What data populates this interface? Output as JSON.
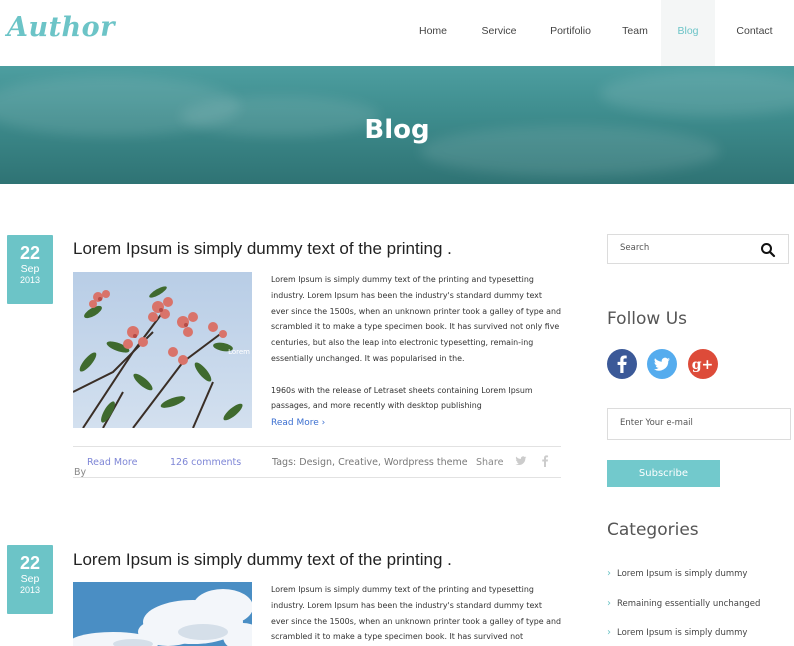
{
  "header": {
    "logo": "Author",
    "nav": [
      {
        "label": "Home",
        "active": false
      },
      {
        "label": "Service",
        "active": false
      },
      {
        "label": "Portifolio",
        "active": false
      },
      {
        "label": "Team",
        "active": false
      },
      {
        "label": "Blog",
        "active": true
      },
      {
        "label": "Contact",
        "active": false
      }
    ]
  },
  "hero": {
    "title": "Blog"
  },
  "posts": [
    {
      "day": "22",
      "month": "Sep",
      "year": "2013",
      "title": "Lorem Ipsum is simply dummy text of the printing .",
      "image_caption": "Lorem",
      "paragraph1": "Lorem Ipsum is simply dummy text of the printing and typesetting industry. Lorem Ipsum has been the industry's standard dummy text ever since the 1500s, when an unknown printer took a galley of type and scrambled it to make a type specimen book. It has survived not only five centuries, but also the leap into electronic typesetting, remain-ing essentially unchanged. It was popularised in the.",
      "paragraph2": "1960s with the release of Letraset sheets containing Lorem Ipsum passages, and more recently with desktop publishing",
      "read_more": "Read More",
      "by_label": "By",
      "by_link": "Read More",
      "comments": "126 comments",
      "tags": "Tags: Design, Creative, Wordpress theme",
      "share_label": "Share"
    },
    {
      "day": "22",
      "month": "Sep",
      "year": "2013",
      "title": "Lorem Ipsum is simply dummy text of the printing .",
      "paragraph1": "Lorem Ipsum is simply dummy text of the printing and typesetting industry. Lorem Ipsum has been the industry's standard dummy text ever since the 1500s, when an unknown printer took a galley of type and scrambled it to make a type specimen book. It has survived not"
    }
  ],
  "sidebar": {
    "search_placeholder": "Search",
    "follow_heading": "Follow Us",
    "social": [
      {
        "name": "facebook",
        "glyph": "f",
        "color": "#3b5998"
      },
      {
        "name": "twitter",
        "glyph": "t",
        "color": "#55acee"
      },
      {
        "name": "google-plus",
        "glyph": "g+",
        "color": "#dd4b39"
      }
    ],
    "email_placeholder": "Enter Your e-mail",
    "subscribe_label": "Subscribe",
    "categories_heading": "Categories",
    "categories": [
      "Lorem Ipsum is simply dummy",
      "Remaining essentially unchanged",
      "Lorem Ipsum is simply dummy"
    ]
  },
  "colors": {
    "accent": "#6cc4c7",
    "link": "#3b6fd0",
    "meta_link": "#7e86d6",
    "hero": "#3d8b8c"
  }
}
